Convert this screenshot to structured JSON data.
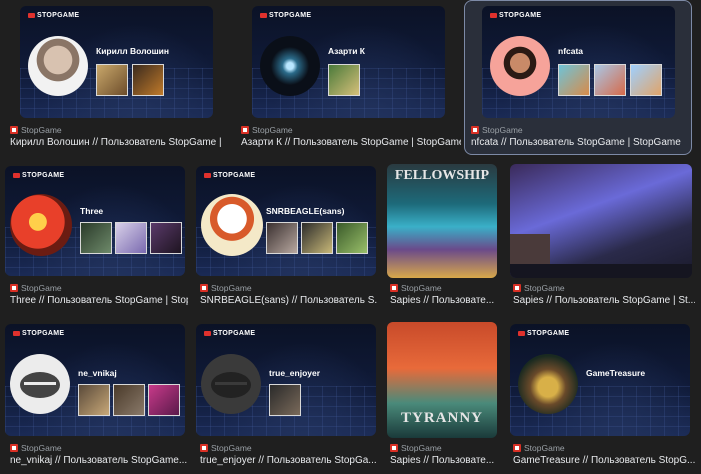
{
  "brand_logo_text": "STOPGAME",
  "colors": {
    "page_bg": "#1f1f1f",
    "accent_red": "#e0312d",
    "selected_border": "#7d8aa6"
  },
  "results": [
    {
      "username": "Кирилл Волошин",
      "source": "StopGame",
      "title": "Кирилл Волошин // Пользователь StopGame | ..."
    },
    {
      "username": "Азарти К",
      "source": "StopGame",
      "title": "Азарти К // Пользователь StopGame | StopGame"
    },
    {
      "username": "nfcata",
      "source": "StopGame",
      "title": "nfcata // Пользователь StopGame | StopGame",
      "selected": true
    },
    {
      "username": "Three",
      "source": "StopGame",
      "title": "Three // Пользователь StopGame | Stop..."
    },
    {
      "username": "SNRBEAGLE(sans)",
      "source": "StopGame",
      "title": "SNRBEAGLE(sans) // Пользователь S..."
    },
    {
      "poster_text": "FELLOWSHIP",
      "source": "StopGame",
      "title": "Sapies // Пользовате..."
    },
    {
      "source": "StopGame",
      "title": "Sapies // Пользователь StopGame | St..."
    },
    {
      "username": "ne_vnikaj",
      "source": "StopGame",
      "title": "ne_vnikaj // Пользователь StopGame..."
    },
    {
      "username": "true_enjoyer",
      "source": "StopGame",
      "title": "true_enjoyer // Пользователь StopGa..."
    },
    {
      "poster_text": "TYRANNY",
      "source": "StopGame",
      "title": "Sapies // Пользовате..."
    },
    {
      "username": "GameTreasure",
      "source": "StopGame",
      "title": "GameTreasure // Пользователь StopG..."
    }
  ]
}
